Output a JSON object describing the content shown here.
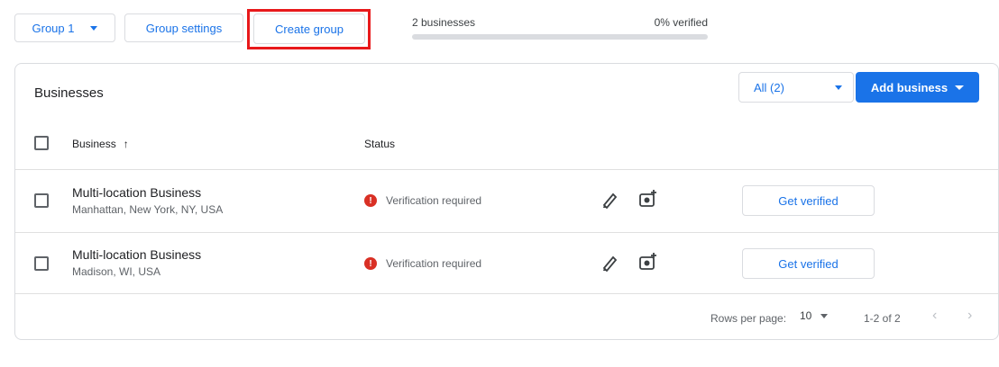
{
  "toolbar": {
    "group_select_label": "Group 1",
    "group_settings_label": "Group settings",
    "create_group_label": "Create group",
    "businesses_count": "2 businesses",
    "verified_percent_label": "0% verified",
    "verified_fraction": 0.0
  },
  "card": {
    "title": "Businesses",
    "filter_label": "All (2)",
    "add_business_label": "Add business",
    "columns": {
      "business": "Business",
      "status": "Status"
    },
    "sort_glyph": "↑",
    "rows": [
      {
        "name": "Multi-location Business",
        "address": "Manhattan, New York, NY, USA",
        "status": "Verification required",
        "action": "Get verified"
      },
      {
        "name": "Multi-location Business",
        "address": "Madison, WI, USA",
        "status": "Verification required",
        "action": "Get verified"
      }
    ],
    "pagination": {
      "rows_per_page_label": "Rows per page:",
      "rows_per_page_value": "10",
      "range_label": "1-2 of 2"
    }
  },
  "colors": {
    "accent": "#1a73e8",
    "highlight": "#e8191b",
    "error": "#d93025"
  }
}
